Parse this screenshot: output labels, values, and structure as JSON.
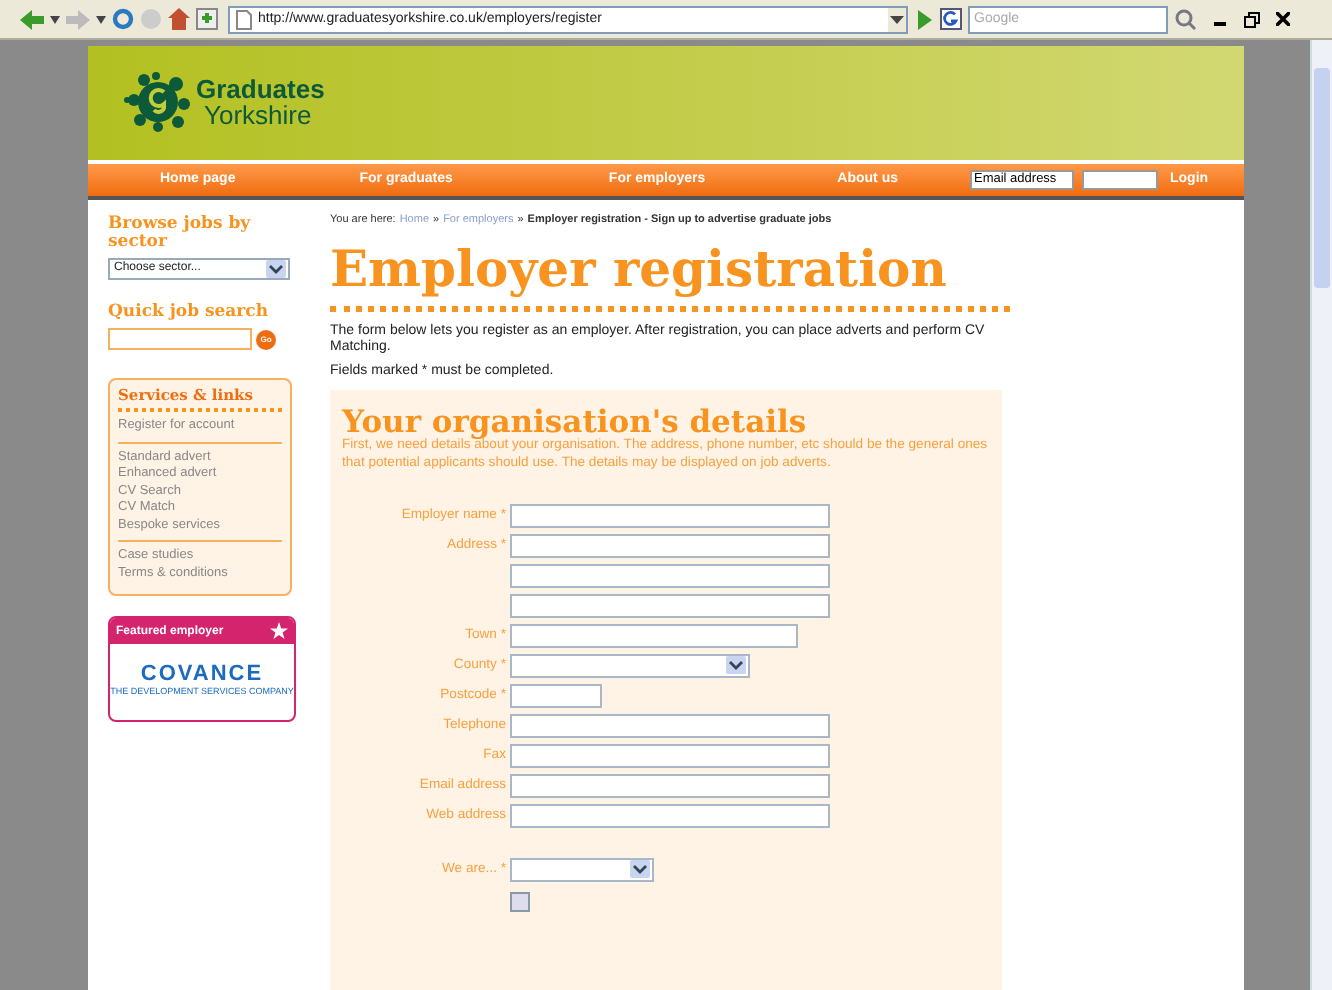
{
  "browser": {
    "url": "http://www.graduatesyorkshire.co.uk/employers/register",
    "search_placeholder": "Google"
  },
  "logo": {
    "line1": "Graduates",
    "line2": "Yorkshire"
  },
  "nav": {
    "items": [
      {
        "label": "Home page"
      },
      {
        "label": "For graduates"
      },
      {
        "label": "For employers"
      },
      {
        "label": "About us"
      }
    ],
    "email_value": "Email address",
    "login": "Login"
  },
  "sidebar": {
    "browse_title": "Browse jobs by sector",
    "sector_value": "Choose sector...",
    "search_title": "Quick job search",
    "go": "Go",
    "services_title": "Services & links",
    "link_groups": [
      [
        "Register for account"
      ],
      [
        "Standard advert",
        "Enhanced advert",
        "CV Search",
        "CV Match",
        "Bespoke services"
      ],
      [
        "Case studies",
        "Terms & conditions"
      ]
    ],
    "featured_title": "Featured employer",
    "featured_logo": "COVANCE",
    "featured_tagline": "THE DEVELOPMENT SERVICES COMPANY"
  },
  "breadcrumb": {
    "prefix": "You are here:",
    "links": [
      "Home",
      "For employers"
    ],
    "separator": "»",
    "current": "Employer registration - Sign up to advertise graduate jobs"
  },
  "page_title": "Employer registration",
  "intro": [
    "The form below lets you register as an employer. After registration, you can place adverts and perform CV Matching.",
    "Fields marked * must be completed."
  ],
  "section": {
    "title": "Your organisation's details",
    "description": "First, we need details about your organisation. The address, phone number, etc should be the general ones that potential applicants should use. The details may be displayed on job adverts.",
    "fields": [
      {
        "label": "Employer name *",
        "kind": "text"
      },
      {
        "label": "Address *",
        "kind": "text"
      },
      {
        "kind": "text"
      },
      {
        "kind": "text"
      },
      {
        "label": "Town *",
        "kind": "text-medium"
      },
      {
        "label": "County *",
        "kind": "select"
      },
      {
        "label": "Postcode *",
        "kind": "text-short"
      },
      {
        "label": "Telephone",
        "kind": "text"
      },
      {
        "label": "Fax",
        "kind": "text"
      },
      {
        "label": "Email address",
        "kind": "text"
      },
      {
        "label": "Web address",
        "kind": "text"
      },
      {
        "kind": "gap"
      },
      {
        "label": "We are... *",
        "kind": "select-short"
      },
      {
        "kind": "checkbox",
        "checked": false
      }
    ]
  }
}
